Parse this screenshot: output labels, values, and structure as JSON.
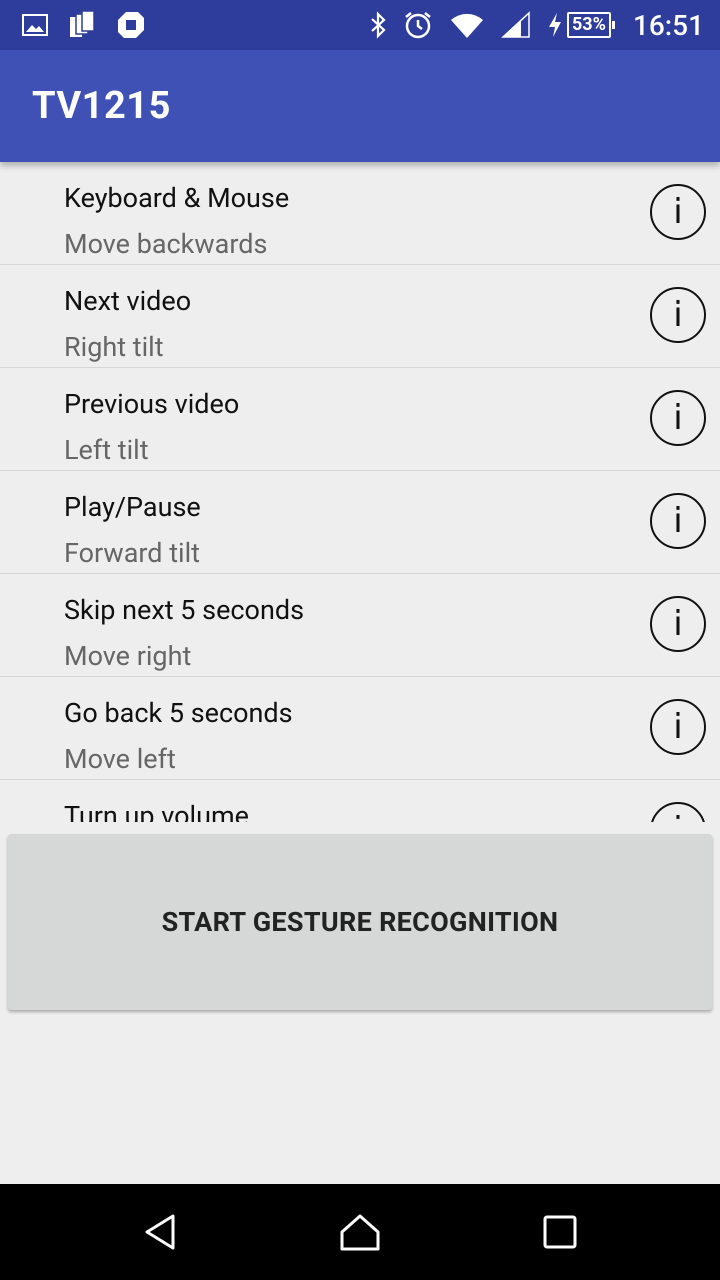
{
  "status_bar": {
    "left_icons": [
      "image-icon",
      "sim-cards-icon",
      "chase-logo-icon"
    ],
    "right_icons": [
      "bluetooth-icon",
      "alarm-icon",
      "wifi-icon",
      "signal-icon",
      "charging-icon"
    ],
    "battery_percent": "53%",
    "time": "16:51"
  },
  "app_bar": {
    "title": "TV1215"
  },
  "gestures": [
    {
      "title": "Keyboard & Mouse",
      "subtitle": "Move backwards",
      "info_icon": "info-icon",
      "info_label": "i"
    },
    {
      "title": "Next video",
      "subtitle": "Right tilt",
      "info_icon": "info-icon",
      "info_label": "i"
    },
    {
      "title": "Previous video",
      "subtitle": "Left tilt",
      "info_icon": "info-icon",
      "info_label": "i"
    },
    {
      "title": "Play/Pause",
      "subtitle": "Forward tilt",
      "info_icon": "info-icon",
      "info_label": "i"
    },
    {
      "title": "Skip next 5 seconds",
      "subtitle": "Move right",
      "info_icon": "info-icon",
      "info_label": "i"
    },
    {
      "title": "Go back 5 seconds",
      "subtitle": "Move left",
      "info_icon": "info-icon",
      "info_label": "i"
    },
    {
      "title": "Turn up volume",
      "subtitle": "",
      "info_icon": "info-icon",
      "info_label": "i"
    }
  ],
  "start_button": {
    "label": "START GESTURE RECOGNITION"
  },
  "nav_bar": {
    "buttons": [
      "back-icon",
      "home-icon",
      "recents-icon"
    ]
  },
  "colors": {
    "status_bar": "#2e3d9c",
    "app_bar": "#3f51b5",
    "background": "#eeeeee",
    "button": "#d6d7d7"
  }
}
